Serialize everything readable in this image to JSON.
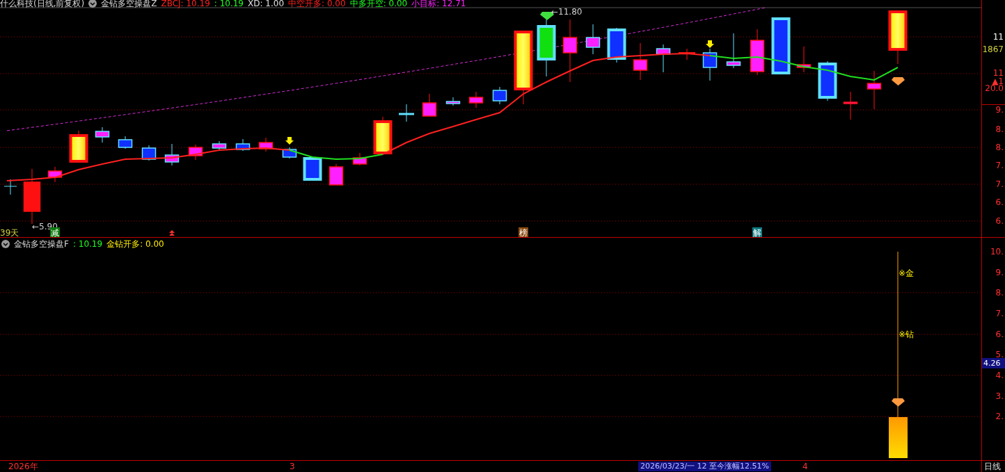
{
  "header": {
    "title": "什么科技(日线,前复权)",
    "indicator": "金钻多空操盘Z",
    "values": [
      {
        "text": "ZBCJ: 10.19",
        "color": "#ff2020"
      },
      {
        "text": ": 10.19",
        "color": "#20ff20"
      },
      {
        "text": "XD: 1.00",
        "color": "#e0e0e0"
      },
      {
        "text": "中空开多: 0.00",
        "color": "#ff2020"
      },
      {
        "text": "中多开空: 0.00",
        "color": "#20ff20"
      },
      {
        "text": "小目标: 12.71",
        "color": "#ff20ff"
      }
    ]
  },
  "main_chart": {
    "high_label": "←11.80",
    "low_label": "←5.90",
    "marks": [
      {
        "text": "39天",
        "kind": "count"
      },
      {
        "text": "减",
        "kind": "signal",
        "color": "#0a7a0a"
      },
      {
        "text": "榜",
        "kind": "signal",
        "color": "#8a4a10"
      },
      {
        "text": "解",
        "kind": "signal",
        "color": "#107a80"
      }
    ]
  },
  "main_axis": [
    {
      "text": "11",
      "color": "#ffffff"
    },
    {
      "text": "1867",
      "color": "#d0d040"
    },
    {
      "text": "11",
      "color": "#ff3030"
    },
    {
      "text": "▲1",
      "color": "#ff3030"
    },
    {
      "text": "20.0",
      "color": "#ff3030"
    },
    {
      "text": "9.",
      "color": "#ff3030"
    },
    {
      "text": "8.",
      "color": "#ff3030"
    },
    {
      "text": "8.",
      "color": "#ff3030"
    },
    {
      "text": "7.",
      "color": "#ff3030"
    },
    {
      "text": "7.",
      "color": "#ff3030"
    },
    {
      "text": "6.",
      "color": "#ff3030"
    },
    {
      "text": "6.",
      "color": "#ff3030"
    }
  ],
  "indicator_panel": {
    "name": "金钻多空操盘F",
    "value": ": 10.19",
    "signal": "金钻开多: 0.00",
    "labels": [
      "※金",
      "※钻"
    ]
  },
  "indicator_axis": [
    {
      "text": "10.",
      "kind": "tick"
    },
    {
      "text": "9.",
      "kind": "tick"
    },
    {
      "text": "8.",
      "kind": "tick"
    },
    {
      "text": "7.",
      "kind": "tick"
    },
    {
      "text": "6.",
      "kind": "tick"
    },
    {
      "text": "5.",
      "kind": "tick"
    },
    {
      "text": "4.26",
      "kind": "current"
    },
    {
      "text": "4.",
      "kind": "tick"
    },
    {
      "text": "3.",
      "kind": "tick"
    },
    {
      "text": "2.",
      "kind": "tick"
    }
  ],
  "time_axis": [
    {
      "text": "2026年",
      "kind": "label"
    },
    {
      "text": "3",
      "kind": "label"
    },
    {
      "text": "2026/03/23/一 12 至今涨幅12.51%",
      "kind": "cursor"
    },
    {
      "text": "4",
      "kind": "label"
    }
  ],
  "period": "日线"
}
